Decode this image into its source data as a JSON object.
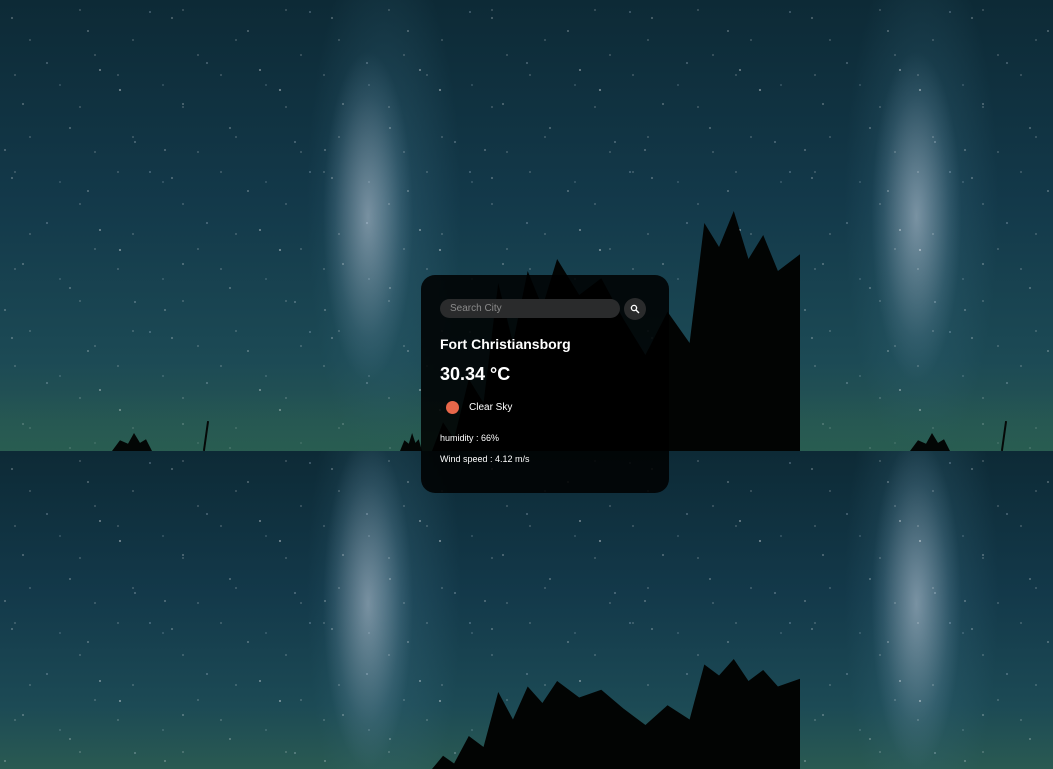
{
  "search": {
    "placeholder": "Search City",
    "value": "",
    "button_icon": "search-icon"
  },
  "weather": {
    "city": "Fort Christiansborg",
    "temperature": "30.34 °C",
    "condition_icon": "sun-icon",
    "condition": "Clear Sky",
    "humidity": "humidity : 66%",
    "wind": "Wind speed : 4.12 m/s"
  },
  "colors": {
    "card_background": "#000000",
    "condition_icon": "#e8674a",
    "text": "#ffffff"
  }
}
